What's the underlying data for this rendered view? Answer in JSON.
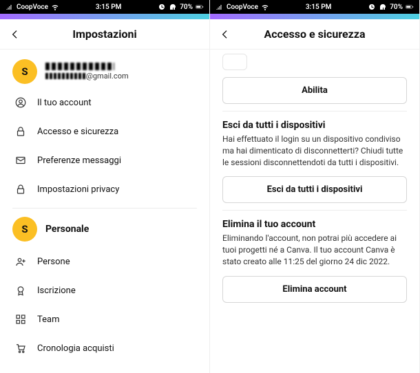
{
  "status": {
    "carrier": "CoopVoce",
    "time": "3:15 PM",
    "battery_pct": "70%"
  },
  "left": {
    "title": "Impostazioni",
    "profile": {
      "initial": "S",
      "email_suffix": "@gmail.com"
    },
    "menu1": [
      {
        "label": "Il tuo account",
        "icon": "person-circle-icon"
      },
      {
        "label": "Accesso e sicurezza",
        "icon": "lock-icon"
      },
      {
        "label": "Preferenze messaggi",
        "icon": "mail-icon"
      },
      {
        "label": "Impostazioni privacy",
        "icon": "lock-icon"
      }
    ],
    "personal_label": "Personale",
    "personal_initial": "S",
    "menu2": [
      {
        "label": "Persone",
        "icon": "people-add-icon"
      },
      {
        "label": "Iscrizione",
        "icon": "badge-icon"
      },
      {
        "label": "Team",
        "icon": "grid-icon"
      },
      {
        "label": "Cronologia acquisti",
        "icon": "cart-icon"
      }
    ]
  },
  "right": {
    "title": "Accesso e sicurezza",
    "enable_btn": "Abilita",
    "logout_all": {
      "heading": "Esci da tutti i dispositivi",
      "body": "Hai effettuato il login su un dispositivo condiviso ma hai dimenticato di disconnetterti? Chiudi tutte le sessioni disconnettendoti da tutti i dispositivi.",
      "button": "Esci da tutti i dispositivi"
    },
    "delete": {
      "heading": "Elimina il tuo account",
      "body": "Eliminando l'account, non potrai più accedere ai tuoi progetti né a Canva. Il tuo account Canva è stato creato alle 11:25 del giorno 24 dic 2022.",
      "button": "Elimina account"
    }
  }
}
